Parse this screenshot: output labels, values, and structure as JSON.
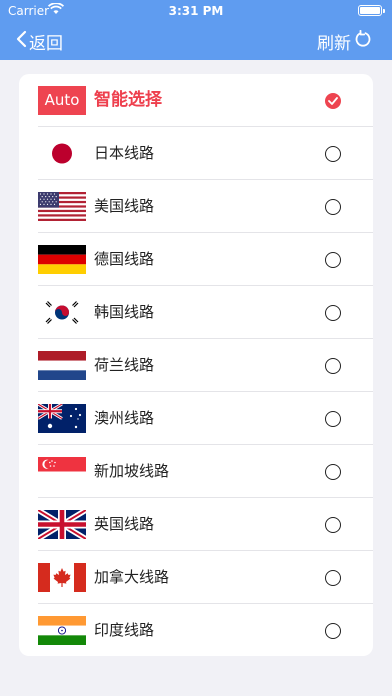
{
  "status": {
    "carrier": "Carrier",
    "time": "3:31 PM"
  },
  "nav": {
    "back_label": "返回",
    "refresh_label": "刷新"
  },
  "routes": [
    {
      "label": "智能选择",
      "badge": "Auto",
      "selected": true
    },
    {
      "label": "日本线路",
      "flag": "japan",
      "selected": false
    },
    {
      "label": "美国线路",
      "flag": "usa",
      "selected": false
    },
    {
      "label": "德国线路",
      "flag": "germany",
      "selected": false
    },
    {
      "label": "韩国线路",
      "flag": "korea",
      "selected": false
    },
    {
      "label": "荷兰线路",
      "flag": "netherlands",
      "selected": false
    },
    {
      "label": "澳州线路",
      "flag": "australia",
      "selected": false
    },
    {
      "label": "新加坡线路",
      "flag": "singapore",
      "selected": false
    },
    {
      "label": "英国线路",
      "flag": "uk",
      "selected": false
    },
    {
      "label": "加拿大线路",
      "flag": "canada",
      "selected": false
    },
    {
      "label": "印度线路",
      "flag": "india",
      "selected": false
    }
  ],
  "colors": {
    "nav_bg": "#5f9cf0",
    "accent": "#ee4450",
    "page_bg": "#f1f1f6"
  }
}
